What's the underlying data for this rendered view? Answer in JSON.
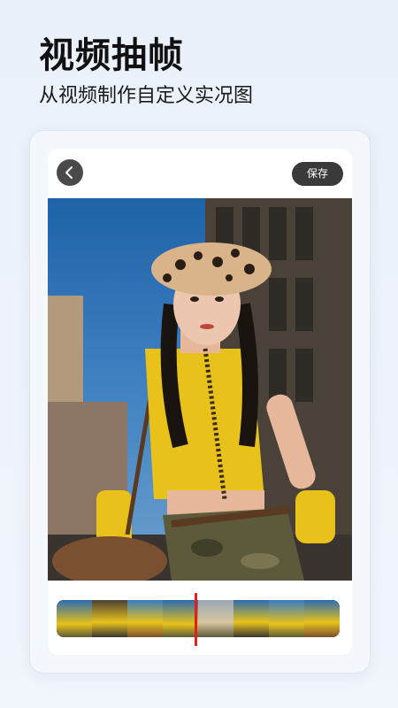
{
  "header": {
    "title": "视频抽帧",
    "subtitle": "从视频制作自定义实况图"
  },
  "toolbar": {
    "save_label": "保存"
  },
  "icons": {
    "back": "chevron-left-icon"
  },
  "timeline": {
    "frame_count": 8
  },
  "colors": {
    "accent_playhead": "#e02020",
    "button_dark": "#3a3a3a"
  }
}
